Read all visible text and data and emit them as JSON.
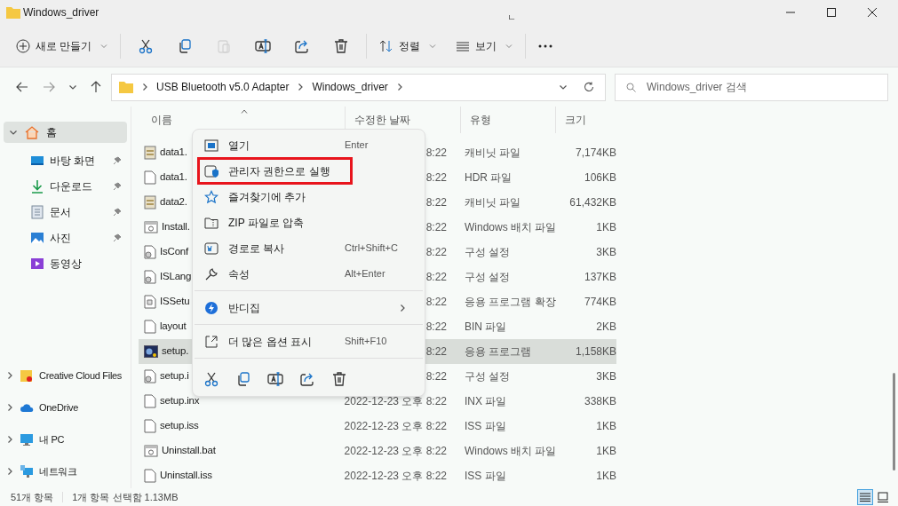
{
  "window": {
    "title": "Windows_driver",
    "ime_mark": "ㄴ"
  },
  "toolbar": {
    "new": "새로 만들기",
    "tools": [
      {
        "kind": "cut",
        "disabled": false
      },
      {
        "kind": "copy",
        "disabled": false
      },
      {
        "kind": "paste",
        "disabled": true
      },
      {
        "kind": "rename",
        "disabled": false
      },
      {
        "kind": "share",
        "disabled": false
      },
      {
        "kind": "delete",
        "disabled": false
      }
    ],
    "sort": "정렬",
    "view": "보기"
  },
  "address": {
    "path": [
      "USB Bluetooth v5.0 Adapter",
      "Windows_driver"
    ],
    "search_placeholder": "Windows_driver 검색"
  },
  "sidebar": {
    "home": {
      "label": "홈",
      "selected": true,
      "expanded": true
    },
    "quick": [
      {
        "label": "바탕 화면",
        "kind": "desktop",
        "pinned": true
      },
      {
        "label": "다운로드",
        "kind": "download",
        "pinned": true
      },
      {
        "label": "문서",
        "kind": "documents",
        "pinned": true
      },
      {
        "label": "사진",
        "kind": "pictures",
        "pinned": true
      },
      {
        "label": "동영상",
        "kind": "videos",
        "pinned": false
      }
    ],
    "roots": [
      {
        "label": "Creative Cloud Files",
        "kind": "cloudfiles",
        "expanded": false
      },
      {
        "label": "OneDrive",
        "kind": "onedrive",
        "expanded": false
      },
      {
        "label": "내 PC",
        "kind": "pc",
        "expanded": false
      },
      {
        "label": "네트워크",
        "kind": "network",
        "expanded": false
      }
    ]
  },
  "table": {
    "columns": [
      "이름",
      "수정한 날짜",
      "유형",
      "크기"
    ],
    "rows": [
      {
        "name": "data1.",
        "kind": "cab",
        "date": "8:22",
        "type": "캐비닛 파일",
        "size": "7,174KB",
        "selected": false
      },
      {
        "name": "data1.",
        "kind": "file",
        "date": "8:22",
        "type": "HDR 파일",
        "size": "106KB",
        "selected": false
      },
      {
        "name": "data2.",
        "kind": "cab",
        "date": "8:22",
        "type": "캐비닛 파일",
        "size": "61,432KB",
        "selected": false
      },
      {
        "name": "Install.",
        "kind": "bat",
        "date": "8:22",
        "type": "Windows 배치 파일",
        "size": "1KB",
        "selected": false
      },
      {
        "name": "IsConf",
        "kind": "ini",
        "date": "8:22",
        "type": "구성 설정",
        "size": "3KB",
        "selected": false
      },
      {
        "name": "ISLang",
        "kind": "ini",
        "date": "8:22",
        "type": "구성 설정",
        "size": "137KB",
        "selected": false
      },
      {
        "name": "ISSetu",
        "kind": "ext",
        "date": "8:22",
        "type": "응용 프로그램 확장",
        "size": "774KB",
        "selected": false
      },
      {
        "name": "layout",
        "kind": "file",
        "date": "8:22",
        "type": "BIN 파일",
        "size": "2KB",
        "selected": false
      },
      {
        "name": "setup.",
        "kind": "exe",
        "date": "8:22",
        "type": "응용 프로그램",
        "size": "1,158KB",
        "selected": true
      },
      {
        "name": "setup.i",
        "kind": "ini",
        "date": "8:22",
        "type": "구성 설정",
        "size": "3KB",
        "selected": false
      },
      {
        "name": "setup.inx",
        "kind": "file",
        "date": "2022-12-23 오후 8:22",
        "type": "INX 파일",
        "size": "338KB",
        "selected": false
      },
      {
        "name": "setup.iss",
        "kind": "file",
        "date": "2022-12-23 오후 8:22",
        "type": "ISS 파일",
        "size": "1KB",
        "selected": false
      },
      {
        "name": "Uninstall.bat",
        "kind": "bat",
        "date": "2022-12-23 오후 8:22",
        "type": "Windows 배치 파일",
        "size": "1KB",
        "selected": false
      },
      {
        "name": "Uninstall.iss",
        "kind": "file",
        "date": "2022-12-23 오후 8:22",
        "type": "ISS 파일",
        "size": "1KB",
        "selected": false
      }
    ]
  },
  "context_menu": {
    "items": [
      {
        "label": "열기",
        "kind": "open",
        "shortcut": "Enter",
        "outlined": false,
        "submenu": false
      },
      {
        "label": "관리자 권한으로 실행",
        "kind": "admin",
        "outlined": true,
        "submenu": false
      },
      {
        "label": "즐겨찾기에 추가",
        "kind": "star",
        "outlined": false,
        "submenu": false
      },
      {
        "label": "ZIP 파일로 압축",
        "kind": "zip",
        "outlined": false,
        "submenu": false
      },
      {
        "label": "경로로 복사",
        "kind": "path",
        "shortcut": "Ctrl+Shift+C",
        "outlined": false,
        "submenu": false
      },
      {
        "label": "속성",
        "kind": "wrench",
        "shortcut": "Alt+Enter",
        "outlined": false,
        "submenu": false,
        "separator_after": true
      },
      {
        "label": "반디집",
        "kind": "bandizip",
        "outlined": false,
        "submenu": true,
        "separator_after": true
      },
      {
        "label": "더 많은 옵션 표시",
        "kind": "more",
        "shortcut": "Shift+F10",
        "outlined": false,
        "submenu": false,
        "separator_after": true
      }
    ],
    "actions": [
      {
        "kind": "cut"
      },
      {
        "kind": "copy"
      },
      {
        "kind": "rename"
      },
      {
        "kind": "share"
      },
      {
        "kind": "delete"
      }
    ]
  },
  "status_bar": {
    "count": "51개 항목",
    "selection": "1개 항목 선택함 1.13MB",
    "views": [
      {
        "kind": "details",
        "selected": true
      },
      {
        "kind": "tiles",
        "selected": false
      }
    ]
  }
}
